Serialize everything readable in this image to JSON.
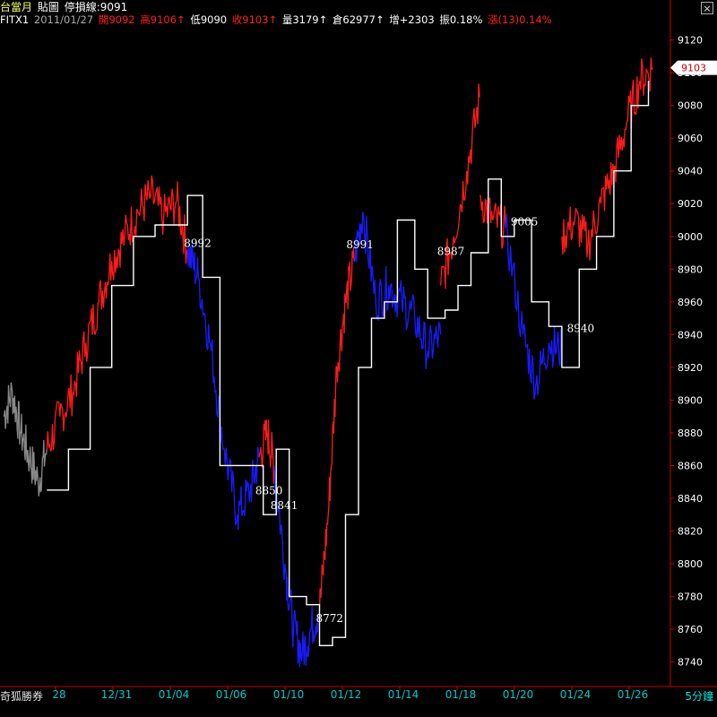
{
  "header": {
    "title": "台當月",
    "mode": "貼圖",
    "stoploss": "停損線:9091",
    "symbol": "FITX1",
    "date": "2011/01/27",
    "open": "開9092",
    "high": "高9106↑",
    "low": "低9090",
    "close": "收9103↑",
    "volume": "量3179↑",
    "oi": "倉62977↑",
    "oi_change": "增+2303",
    "amplitude": "振0.18%",
    "change": "漲(13)0.14%"
  },
  "close_label": "×",
  "footer": {
    "brand": "奇狐勝券",
    "period": "5分鐘"
  },
  "colors": {
    "up": "#ff1a1a",
    "down": "#1a1aff",
    "neutral": "#888888",
    "stopline": "#ffffff",
    "axis": "#cc0000",
    "xlabel": "#00c8c8",
    "ylabel": "#ffffff",
    "yellow": "#ffff66"
  },
  "chart_data": {
    "type": "line",
    "yticks": [
      8740,
      8760,
      8780,
      8800,
      8820,
      8840,
      8860,
      8880,
      8900,
      8920,
      8940,
      8960,
      8980,
      9000,
      9020,
      9040,
      9060,
      9080,
      9100,
      9120
    ],
    "ylim": [
      8725,
      9128
    ],
    "xlabels": [
      "28",
      "12/31",
      "01/04",
      "01/06",
      "01/10",
      "01/12",
      "01/14",
      "01/18",
      "01/20",
      "01/24",
      "01/26"
    ],
    "last_price": "9103",
    "price_series": [
      {
        "color": "neutral",
        "points": [
          [
            0,
            8890
          ],
          [
            0.2,
            8905
          ],
          [
            0.4,
            8880
          ],
          [
            0.6,
            8865
          ],
          [
            0.8,
            8850
          ],
          [
            1,
            8870
          ]
        ]
      },
      {
        "color": "up",
        "points": [
          [
            1,
            8870
          ],
          [
            1.3,
            8890
          ],
          [
            1.6,
            8905
          ],
          [
            1.9,
            8935
          ],
          [
            2.2,
            8960
          ],
          [
            2.5,
            8985
          ],
          [
            2.8,
            9000
          ],
          [
            3.1,
            9015
          ],
          [
            3.4,
            9025
          ],
          [
            3.7,
            9012
          ],
          [
            4,
            9022
          ],
          [
            4.25,
            8992
          ]
        ]
      },
      {
        "color": "down",
        "points": [
          [
            4.25,
            8992
          ],
          [
            4.5,
            8975
          ],
          [
            4.8,
            8930
          ],
          [
            5.1,
            8870
          ],
          [
            5.4,
            8830
          ],
          [
            5.7,
            8845
          ],
          [
            5.9,
            8865
          ]
        ]
      },
      {
        "color": "up",
        "points": [
          [
            5.9,
            8865
          ],
          [
            6.1,
            8880
          ],
          [
            6.25,
            8860
          ]
        ]
      },
      {
        "color": "down",
        "points": [
          [
            6.25,
            8860
          ],
          [
            6.5,
            8800
          ],
          [
            6.7,
            8760
          ],
          [
            6.9,
            8745
          ],
          [
            7.1,
            8760
          ],
          [
            7.3,
            8772
          ]
        ]
      },
      {
        "color": "up",
        "points": [
          [
            7.3,
            8772
          ],
          [
            7.5,
            8830
          ],
          [
            7.7,
            8920
          ],
          [
            7.9,
            8960
          ],
          [
            8.1,
            8985
          ]
        ]
      },
      {
        "color": "down",
        "points": [
          [
            8.1,
            8985
          ],
          [
            8.3,
            9015
          ],
          [
            8.6,
            8960
          ],
          [
            8.9,
            8970
          ],
          [
            9.2,
            8960
          ],
          [
            9.5,
            8950
          ],
          [
            9.8,
            8930
          ],
          [
            10.1,
            8940
          ]
        ]
      },
      {
        "color": "up",
        "points": [
          [
            10.1,
            8970
          ],
          [
            10.4,
            9000
          ],
          [
            10.7,
            9040
          ],
          [
            11,
            9085
          ]
        ]
      },
      {
        "color": "up",
        "points": [
          [
            11,
            9025
          ],
          [
            11.3,
            9010
          ],
          [
            11.6,
            9005
          ]
        ]
      },
      {
        "color": "down",
        "points": [
          [
            11.6,
            9005
          ],
          [
            12,
            8940
          ],
          [
            12.3,
            8910
          ],
          [
            12.6,
            8935
          ],
          [
            12.9,
            8930
          ]
        ]
      },
      {
        "color": "up",
        "points": [
          [
            12.9,
            9000
          ],
          [
            13.2,
            9010
          ],
          [
            13.5,
            8995
          ],
          [
            13.8,
            9020
          ],
          [
            14.1,
            9040
          ],
          [
            14.4,
            9070
          ],
          [
            14.7,
            9095
          ],
          [
            15,
            9103
          ]
        ]
      }
    ],
    "stop_line": [
      [
        1,
        8845
      ],
      [
        1.5,
        8870
      ],
      [
        2,
        8920
      ],
      [
        2.5,
        8970
      ],
      [
        3,
        9000
      ],
      [
        3.5,
        9007
      ],
      [
        4,
        9007
      ],
      [
        4.25,
        9025
      ],
      [
        4.6,
        8975
      ],
      [
        5,
        8860
      ],
      [
        5.5,
        8860
      ],
      [
        5.9,
        8860
      ],
      [
        6,
        8830
      ],
      [
        6.3,
        8870
      ],
      [
        6.6,
        8780
      ],
      [
        7,
        8775
      ],
      [
        7.3,
        8750
      ],
      [
        7.6,
        8755
      ],
      [
        7.9,
        8830
      ],
      [
        8.2,
        8920
      ],
      [
        8.5,
        8950
      ],
      [
        8.8,
        8960
      ],
      [
        9.1,
        9010
      ],
      [
        9.5,
        8980
      ],
      [
        9.8,
        8950
      ],
      [
        10.2,
        8955
      ],
      [
        10.5,
        8970
      ],
      [
        10.8,
        8990
      ],
      [
        11.2,
        9035
      ],
      [
        11.5,
        9000
      ],
      [
        11.8,
        9010
      ],
      [
        12.2,
        8960
      ],
      [
        12.6,
        8945
      ],
      [
        12.9,
        8920
      ],
      [
        13.3,
        8980
      ],
      [
        13.7,
        9000
      ],
      [
        14.1,
        9040
      ],
      [
        14.5,
        9080
      ],
      [
        14.9,
        9095
      ]
    ],
    "annotations": [
      {
        "x": 4.25,
        "y": 8992,
        "label": "8992"
      },
      {
        "x": 6.25,
        "y": 8841,
        "label": "8841"
      },
      {
        "x": 5.9,
        "y": 8850,
        "label": "8850"
      },
      {
        "x": 7.3,
        "y": 8772,
        "label": "8772"
      },
      {
        "x": 8.0,
        "y": 8991,
        "label": "8991"
      },
      {
        "x": 10.1,
        "y": 8987,
        "label": "8987"
      },
      {
        "x": 11.8,
        "y": 9005,
        "label": "9005"
      },
      {
        "x": 13.1,
        "y": 8940,
        "label": "8940"
      }
    ]
  }
}
